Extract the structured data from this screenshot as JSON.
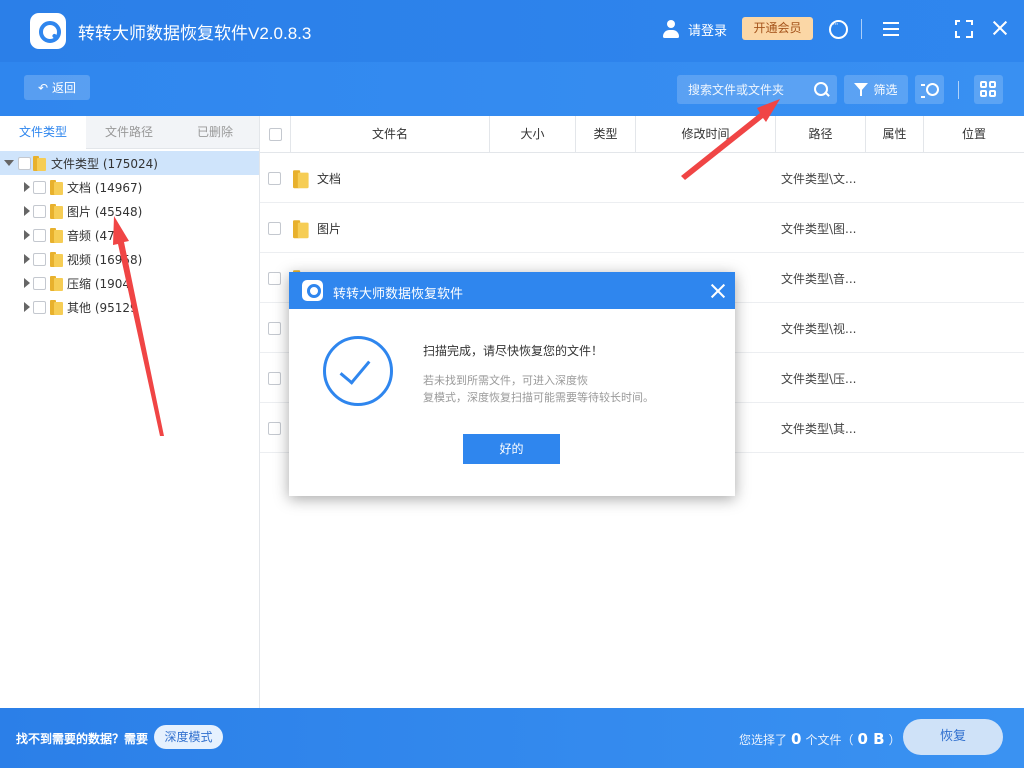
{
  "app": {
    "title": "转转大师数据恢复软件V2.0.8.3",
    "login_label": "请登录",
    "vip_label": "开通会员"
  },
  "toolbar": {
    "back_label": "返回",
    "search_placeholder": "搜索文件或文件夹",
    "filter_label": "筛选"
  },
  "left_tabs": [
    "文件类型",
    "文件路径",
    "已删除"
  ],
  "tree": {
    "root": {
      "label": "文件类型 (175024)"
    },
    "items": [
      {
        "label": "文档 (14967)"
      },
      {
        "label": "图片 (45548)"
      },
      {
        "label": "音频 (47"
      },
      {
        "label": "视频 (16958)"
      },
      {
        "label": "压缩 (1904"
      },
      {
        "label": "其他 (95129"
      }
    ]
  },
  "table": {
    "headers": [
      "文件名",
      "大小",
      "类型",
      "修改时间",
      "路径",
      "属性",
      "位置"
    ],
    "rows": [
      {
        "name": "文档",
        "path": "文件类型\\文..."
      },
      {
        "name": "图片",
        "path": "文件类型\\图..."
      },
      {
        "name": "",
        "path": "文件类型\\音..."
      },
      {
        "name": "",
        "path": "文件类型\\视..."
      },
      {
        "name": "",
        "path": "文件类型\\压..."
      },
      {
        "name": "",
        "path": "文件类型\\其..."
      }
    ]
  },
  "dialog": {
    "title": "转转大师数据恢复软件",
    "message": "扫描完成，请尽快恢复您的文件！",
    "sub_line1": "若未找到所需文件，可进入深度恢",
    "sub_line2": "复模式，深度恢复扫描可能需要等待较长时间。",
    "ok_label": "好的"
  },
  "bottom": {
    "not_found": "找不到需要的数据？需要",
    "deep_mode_label": "深度模式",
    "selected_prefix": "您选择了",
    "selected_count": "0",
    "selected_mid": "个文件（",
    "selected_size": "0 B",
    "selected_suffix": "）",
    "recover_label": "恢复"
  },
  "colors": {
    "primary": "#2f86ee",
    "vip_bg": "#fbd7a6",
    "vip_text": "#a5541b",
    "annotation_arrow": "#f04545"
  }
}
